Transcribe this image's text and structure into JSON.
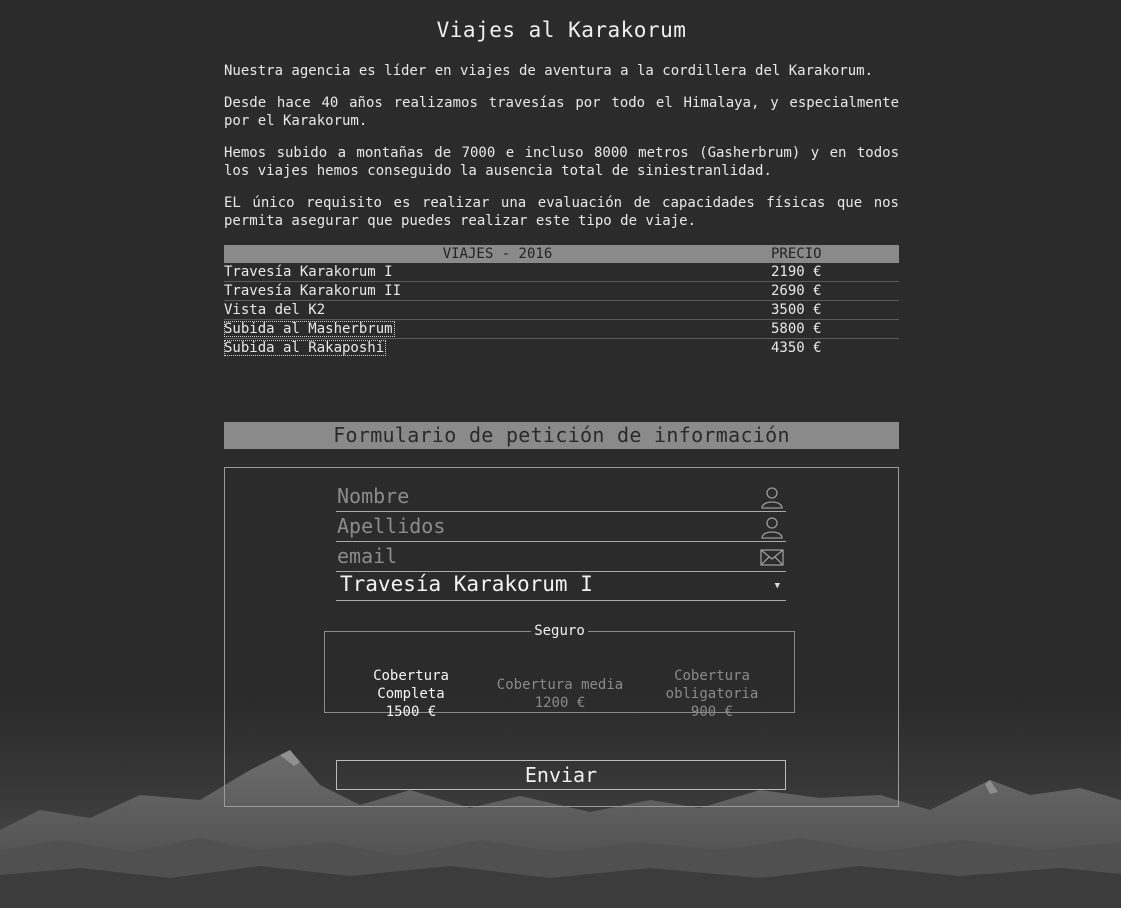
{
  "page": {
    "title": "Viajes al Karakorum",
    "intro": [
      "Nuestra agencia es líder en viajes de aventura a la cordillera del Karakorum.",
      "Desde hace 40 años realizamos travesías por todo el Himalaya, y especialmente por el Karakorum.",
      "Hemos subido a montañas de 7000 e incluso 8000 metros (Gasherbrum) y en todos los viajes hemos conseguido la ausencia total de siniestranlidad.",
      "EL único requisito es realizar una evaluación de capacidades físicas que nos permita asegurar que puedes realizar este tipo de viaje."
    ]
  },
  "trips_table": {
    "headers": [
      "VIAJES - 2016",
      "PRECIO"
    ],
    "rows": [
      {
        "name": "Travesía Karakorum I",
        "price": "2190 €"
      },
      {
        "name": "Travesía Karakorum II",
        "price": "2690 €"
      },
      {
        "name": "Vista del K2",
        "price": "3500 €"
      },
      {
        "name": "Subida al Masherbrum",
        "price": "5800 €"
      },
      {
        "name": "Subida al Rakaposhi",
        "price": "4350 €"
      }
    ]
  },
  "form": {
    "title": "Formulario de petición de información",
    "nombre_placeholder": "Nombre",
    "apellidos_placeholder": "Apellidos",
    "email_placeholder": "email",
    "trip_selected": "Travesía Karakorum I",
    "insurance": {
      "legend": "Seguro",
      "options": [
        {
          "line1": "Cobertura",
          "line2": "Completa",
          "price": "1500 €",
          "selected": true
        },
        {
          "line1": "Cobertura media",
          "line2": "",
          "price": "1200 €",
          "selected": false
        },
        {
          "line1": "Cobertura",
          "line2": "obligatoria",
          "price": "900 €",
          "selected": false
        }
      ]
    },
    "submit_label": "Enviar"
  },
  "icons": {
    "nombre": "user-icon",
    "apellidos": "user-icon",
    "email": "envelope-icon",
    "select": "caret-down-icon"
  },
  "colors": {
    "background": "#2b2b2b",
    "header_bar": "#8a8a8a",
    "text": "#e8e8e8",
    "placeholder": "#8c8c8c"
  }
}
